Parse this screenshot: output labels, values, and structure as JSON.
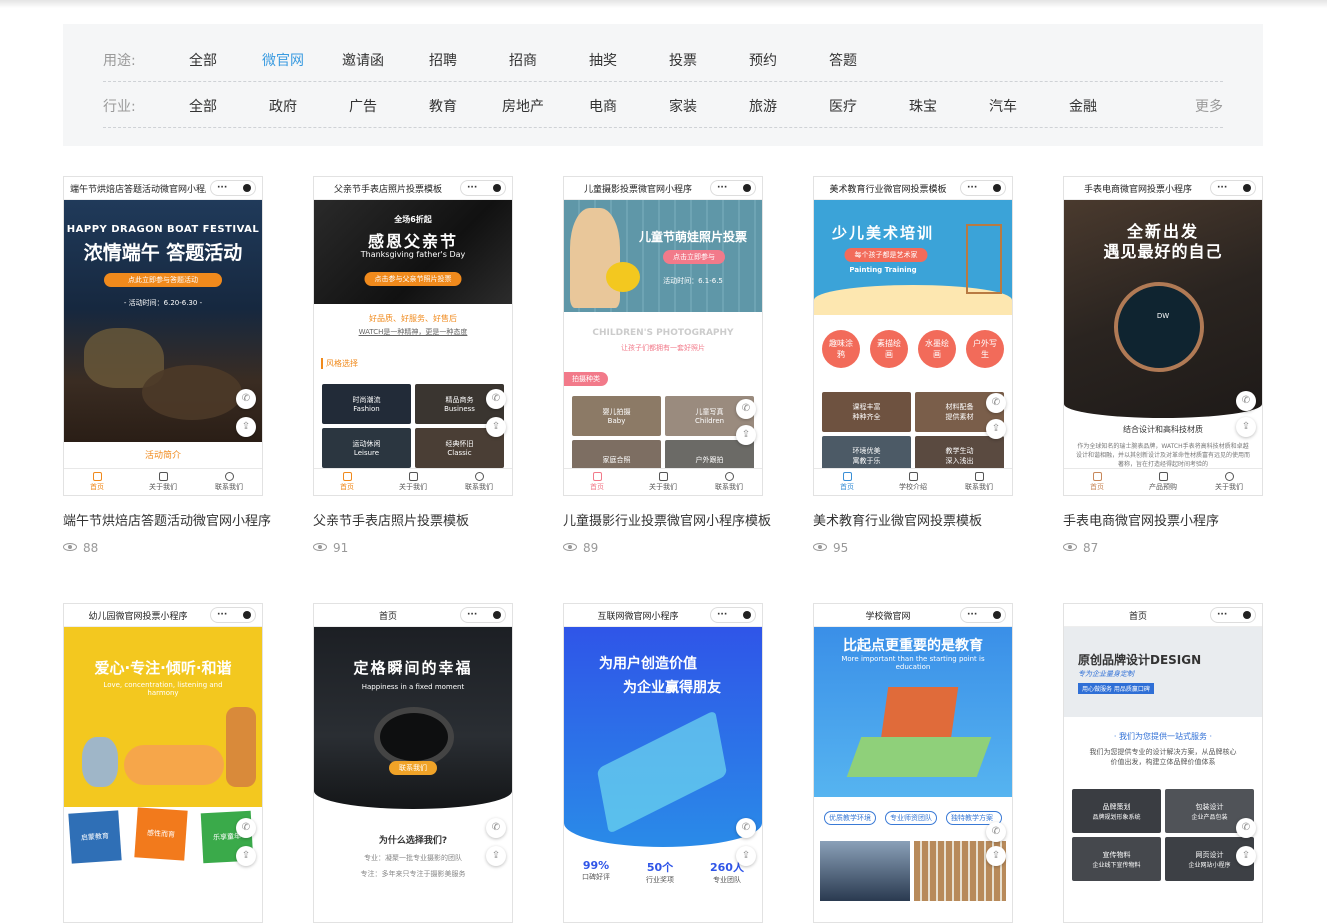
{
  "filter": {
    "purpose_label": "用途:",
    "purpose_items": [
      "全部",
      "微官网",
      "邀请函",
      "招聘",
      "招商",
      "抽奖",
      "投票",
      "预约",
      "答题"
    ],
    "industry_label": "行业:",
    "industry_items": [
      "全部",
      "政府",
      "广告",
      "教育",
      "房地产",
      "电商",
      "家装",
      "旅游",
      "医疗",
      "珠宝",
      "汽车",
      "金融"
    ],
    "more": "更多",
    "active_color": "#3a9be0"
  },
  "cards": [
    {
      "page_title": "端午节烘焙店答题活动微官网小程序",
      "name": "端午节烘焙店答题活动微官网小程序",
      "views": "88",
      "hero_en": "HAPPY DRAGON BOAT FESTIVAL",
      "hero_title": "浓情端午 答题活动",
      "hero_btn": "点此立即参与答题活动",
      "hero_date": "- 活动时间：6.20-6.30 -",
      "section": "活动简介",
      "tabs": [
        "首页",
        "关于我们",
        "联系我们"
      ]
    },
    {
      "page_title": "父亲节手表店照片投票模板",
      "name": "父亲节手表店照片投票模板",
      "views": "91",
      "hero_small": "全场6折起",
      "hero_title": "感恩父亲节",
      "hero_en": "Thanksgiving father's Day",
      "hero_btn": "点击参与父亲节照片投票",
      "slogan": "好品质、好服务、好售后",
      "slogan2": "WATCH是一种精神，更是一种态度",
      "section": "风格选择",
      "grid": [
        [
          "时尚潮流",
          "Fashion"
        ],
        [
          "精品商务",
          "Business"
        ],
        [
          "运动休闲",
          "Leisure"
        ],
        [
          "经典怀旧",
          "Classic"
        ]
      ],
      "tabs": [
        "首页",
        "关于我们",
        "联系我们"
      ]
    },
    {
      "page_title": "儿童摄影投票微官网小程序",
      "name": "儿童摄影行业投票微官网小程序模板",
      "views": "89",
      "hero_title": "儿童节萌娃照片投票",
      "hero_btn": "点击立即参与",
      "hero_date": "活动时间：6.1-6.5",
      "en_title": "CHILDREN'S PHOTOGRAPHY",
      "sub": "让孩子们都拥有一套好照片",
      "badge": "拍摄种类",
      "grid": [
        [
          "婴儿拍摄",
          "Baby"
        ],
        [
          "儿童写真",
          "Children"
        ],
        [
          "家庭合照",
          ""
        ],
        [
          "户外跟拍",
          ""
        ]
      ],
      "tabs": [
        "首页",
        "关于我们",
        "联系我们"
      ]
    },
    {
      "page_title": "美术教育行业微官网投票模板",
      "name": "美术教育行业微官网投票模板",
      "views": "95",
      "hero_title": "少儿美术培训",
      "hero_sub": "每个孩子都是艺术家",
      "hero_en": "Painting Training",
      "circles": [
        "趣味涂鸦",
        "素描绘画",
        "水墨绘画",
        "户外写生"
      ],
      "grid": [
        [
          "课程丰富",
          "种种齐全"
        ],
        [
          "材料配备",
          "提供素材"
        ],
        [
          "环境优美",
          "寓教于乐"
        ],
        [
          "教学生动",
          "深入浅出"
        ]
      ],
      "tabs": [
        "首页",
        "学校介绍",
        "联系我们"
      ]
    },
    {
      "page_title": "手表电商微官网投票小程序",
      "name": "手表电商微官网投票小程序",
      "views": "87",
      "hero_title": "全新出发",
      "hero_title2": "遇见最好的自己",
      "dial_brand": "DW",
      "section": "结合设计和高科技材质",
      "body": "作为全球知名的瑞士腕表品牌，WATCH手表将高科技材质和卓越设计和谐相融，并以其创新设计及对革命性材质富有远见的使用而著称，旨在打造经得起时间考验的",
      "tabs": [
        "首页",
        "产品预购",
        "关于我们"
      ]
    },
    {
      "page_title": "幼儿园微官网投票小程序",
      "hero_title": "爱心·专注·倾听·和谐",
      "hero_en": "Love, concentration, listening and harmony",
      "blocks": [
        "启蒙教育",
        "感性而育",
        "乐享童年"
      ]
    },
    {
      "page_title": "首页",
      "hero_title": "定格瞬间的幸福",
      "hero_en": "Happiness in a fixed moment",
      "hero_btn": "联系我们",
      "section": "为什么选择我们?",
      "lines": [
        "专业：凝聚一批专业摄影的团队",
        "专注：多年来只专注于摄影美服务"
      ]
    },
    {
      "page_title": "互联网微官网小程序",
      "hero_title": "为用户创造价值",
      "hero_title2": "为企业赢得朋友",
      "stats": [
        [
          "99%",
          "口碑好评"
        ],
        [
          "50个",
          "行业奖项"
        ],
        [
          "260人",
          "专业团队"
        ]
      ]
    },
    {
      "page_title": "学校微官网",
      "hero_title": "比起点更重要的是教育",
      "hero_en": "More important than the starting point is education",
      "tags": [
        "优质教学环境",
        "专业师资团队",
        "独特教学方案"
      ]
    },
    {
      "page_title": "首页",
      "hero_title": "原创品牌设计DESIGN",
      "hero_sub": "专为企业量身定制",
      "hero_btn": "用心做服务 用品质赢口碑",
      "section": "· 我们为您提供一站式服务 ·",
      "body": "我们为您提供专业的设计解决方案，从品牌核心价值出发，构建立体品牌价值体系",
      "grid": [
        [
          "品牌策划",
          "品牌规划形象系统"
        ],
        [
          "包装设计",
          "企业产品包装"
        ],
        [
          "宣传物料",
          "企业线下宣传物料"
        ],
        [
          "网页设计",
          "企业网站小程序"
        ]
      ]
    }
  ]
}
